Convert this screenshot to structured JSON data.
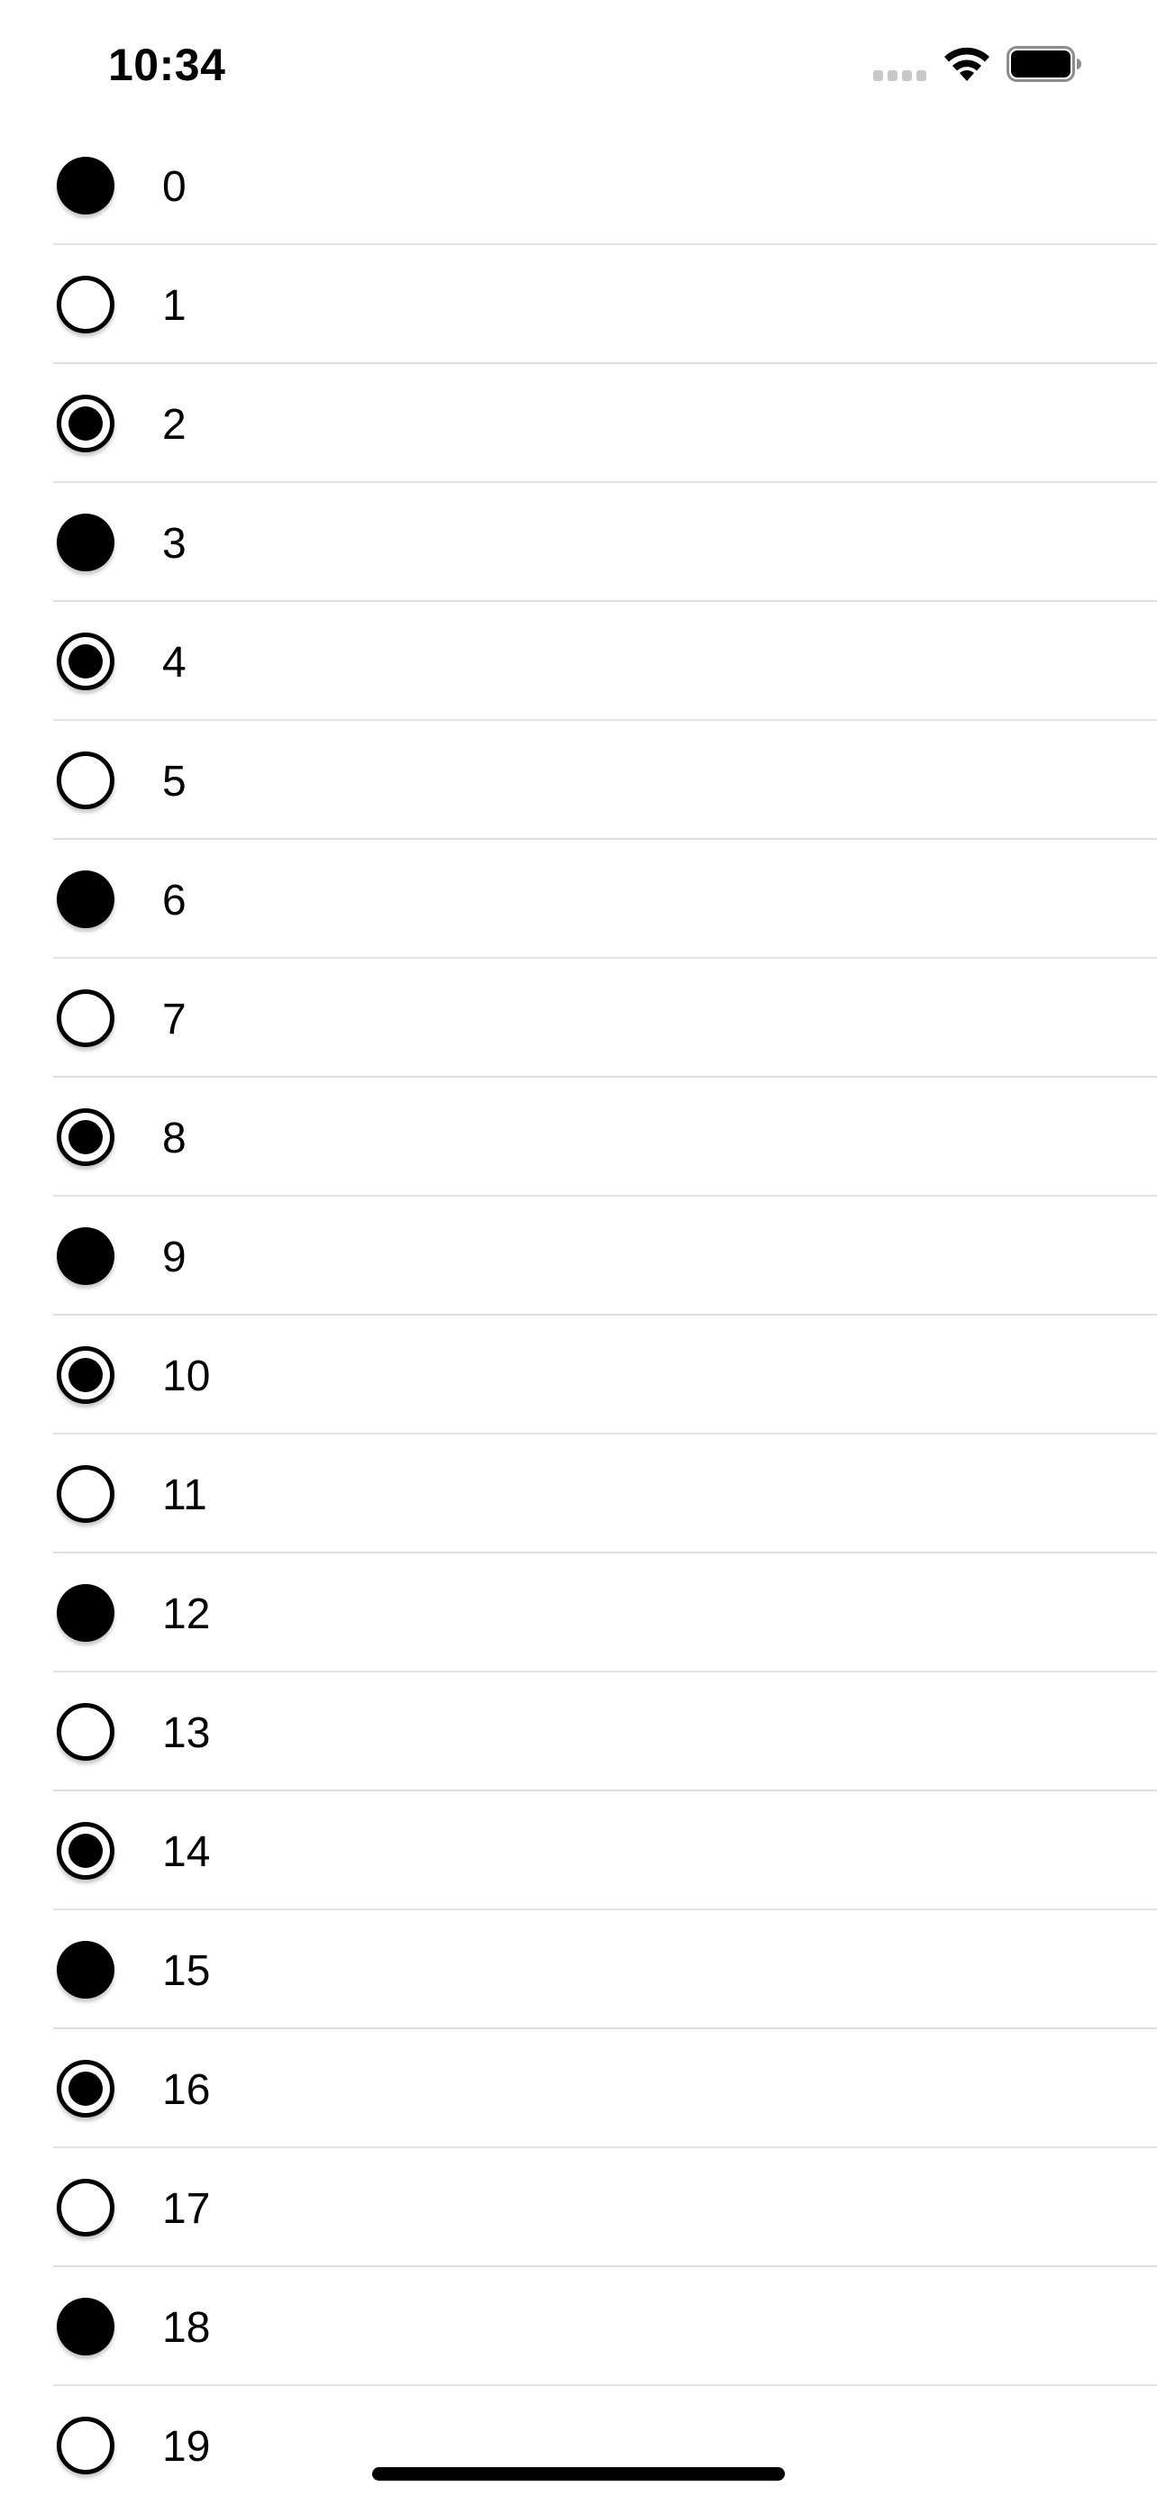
{
  "status_bar": {
    "time": "10:34",
    "signal_icon": "cellular-signal-icon",
    "wifi_icon": "wifi-icon",
    "battery_icon": "battery-full-icon"
  },
  "list": {
    "items": [
      {
        "label": "0",
        "state": "filled"
      },
      {
        "label": "1",
        "state": "empty"
      },
      {
        "label": "2",
        "state": "dot"
      },
      {
        "label": "3",
        "state": "filled"
      },
      {
        "label": "4",
        "state": "dot"
      },
      {
        "label": "5",
        "state": "empty"
      },
      {
        "label": "6",
        "state": "filled"
      },
      {
        "label": "7",
        "state": "empty"
      },
      {
        "label": "8",
        "state": "dot"
      },
      {
        "label": "9",
        "state": "filled"
      },
      {
        "label": "10",
        "state": "dot"
      },
      {
        "label": "11",
        "state": "empty"
      },
      {
        "label": "12",
        "state": "filled"
      },
      {
        "label": "13",
        "state": "empty"
      },
      {
        "label": "14",
        "state": "dot"
      },
      {
        "label": "15",
        "state": "filled"
      },
      {
        "label": "16",
        "state": "dot"
      },
      {
        "label": "17",
        "state": "empty"
      },
      {
        "label": "18",
        "state": "filled"
      },
      {
        "label": "19",
        "state": "empty"
      }
    ]
  },
  "colors": {
    "background": "#ffffff",
    "foreground": "#000000",
    "separator": "#e0e0e0",
    "signal_inactive": "#c8c8c8"
  }
}
